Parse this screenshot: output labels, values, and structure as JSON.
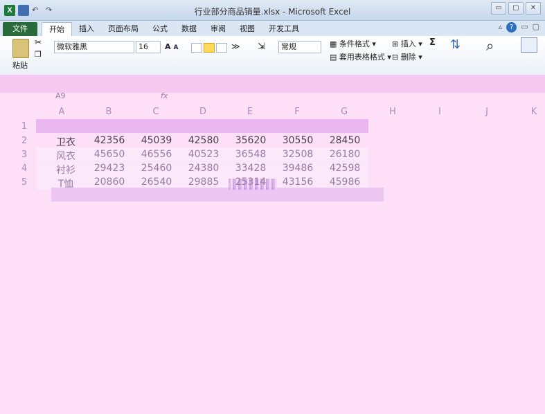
{
  "window": {
    "title": "行业部分商品销量.xlsx - Microsoft Excel",
    "controls": [
      "▭",
      "▢",
      "✕"
    ]
  },
  "qat": {
    "app_icon": "X",
    "undo": "↶",
    "redo": "↷"
  },
  "ribbon": {
    "tabs": [
      "文件",
      "开始",
      "插入",
      "页面布局",
      "公式",
      "数据",
      "审阅",
      "视图",
      "开发工具"
    ],
    "active_tab": "开始",
    "paste_label": "粘贴",
    "font_name": "微软雅黑",
    "font_size": "16",
    "number_format": "常规",
    "cond_format": "条件格式",
    "table_format": "套用表格格式",
    "insert": "插入",
    "delete": "删除",
    "sum": "Σ",
    "grow_font": "A",
    "shrink_font": "A"
  },
  "formula_bar": {
    "name_box": "A9",
    "fx": "fx"
  },
  "sheet": {
    "columns": [
      "A",
      "B",
      "C",
      "D",
      "E",
      "F",
      "G",
      "H",
      "I",
      "J",
      "K"
    ],
    "row_numbers": [
      "1",
      "2",
      "3",
      "4",
      "5"
    ],
    "rows": [
      [
        "卫衣",
        "42356",
        "45039",
        "42580",
        "35620",
        "30550",
        "28450"
      ],
      [
        "风衣",
        "45650",
        "46556",
        "40523",
        "36548",
        "32508",
        "26180"
      ],
      [
        "衬衫",
        "29423",
        "25460",
        "24380",
        "33428",
        "39486",
        "42598"
      ],
      [
        "T恤",
        "20860",
        "26540",
        "29885",
        "25314",
        "43156",
        "45986"
      ]
    ]
  },
  "colors": {
    "glitch_pink": "#fde0f8",
    "header_pink": "#e9b6f0",
    "excel_green": "#1d7a3a"
  }
}
